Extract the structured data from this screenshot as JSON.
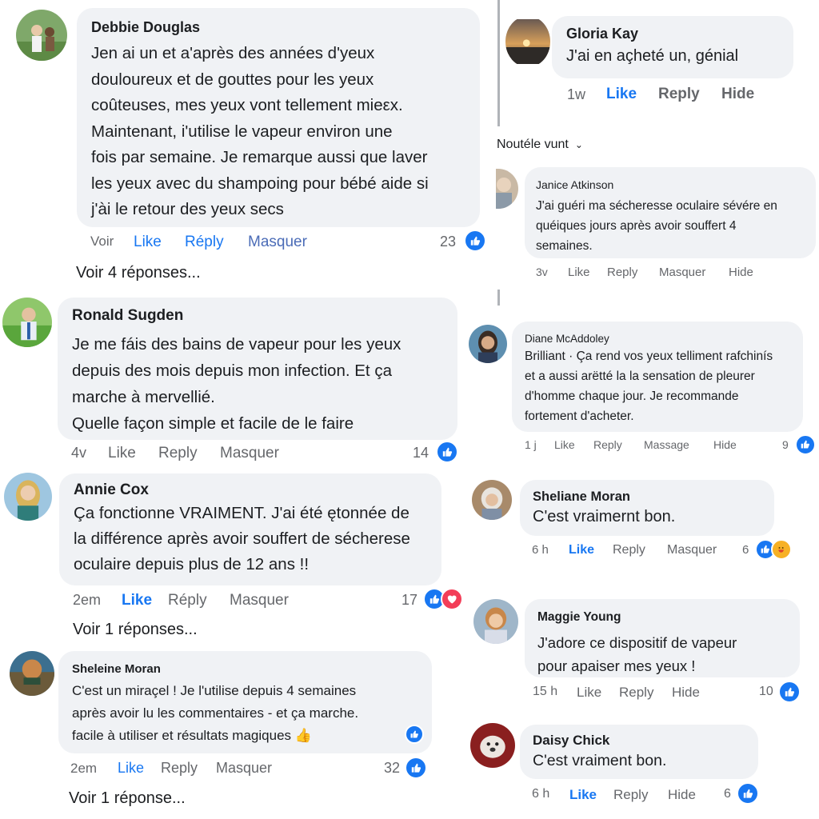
{
  "left": [
    {
      "name": "Debbie Douglas",
      "text": "Jen ai un et a'après des années d'yeux\ndouloureux et de gouttes pour les yeux\ncoûteuses, mes yeux vont tellement mieεx.\nMaintenant, i'utilise le vapeur environ une\nfois par semaine. Je remarque aussi que laver\nles yeux avec du shampoing pour bébé aide si\nj'ài le retour des yeux secs",
      "time": "Voir",
      "like": "Like",
      "reply": "Réply",
      "hide": "Masquer",
      "count": "23",
      "more": "Voir 4 réponses..."
    },
    {
      "name": "Ronald Sugden",
      "text": "Je me fáis des bains de vapeur pour les yeux\ndepuis des mois depuis mon infection. Et ça\nmarche à mervellié.\nQuelle façon simple et facile de le faire",
      "time": "4v",
      "like": "Like",
      "reply": "Reply",
      "hide": "Masquer",
      "count": "14"
    },
    {
      "name": "Annie Cox",
      "text": "Ça fonctionne VRAIMENT. J'ai été ętonnée de\nla différence après avoir souffert de sécherese\noculaire depuis plus de 12 ans !!",
      "time": "2em",
      "like": "Like",
      "reply": "Réply",
      "hide": "Masquer",
      "count": "17",
      "more": "Voir 1 réponses..."
    },
    {
      "name": "Sheleine Moran",
      "text": "C'est un miraçel ! Je l'utilise depuis 4 semaines\naprès avoir lu les commentaires - et ça marche.\nfacile à utiliser et résultats magiques 👍",
      "time": "2em",
      "like": "Like",
      "reply": "Reply",
      "hide": "Masquer",
      "count": "32",
      "more": "Voir 1 réponse..."
    }
  ],
  "right": [
    {
      "name": "Gloria Kay",
      "text": "J'ai en açheté un, génial",
      "time": "1w",
      "like": "Like",
      "reply": "Reply",
      "hide": "Hide"
    },
    {
      "name": "Janice Atkinson",
      "text": "J'ai guéri ma sécheresse oculaire sévére en\nquéiques jours après avoir souffert 4\nsemaines.",
      "time": "3v",
      "like": "Like",
      "reply": "Reply",
      "hide": "Masquer",
      "hide2": "Hide"
    },
    {
      "name": "Diane McAddoley",
      "text": "Brilliant · Ça rend vos yeux telliment rafchinís\net a aussi arëtté la la sensation de pleurer\nd'homme chaque jour. Je recommande\nfortement d'acheter.",
      "time": "1 j",
      "like": "Like",
      "reply": "Reply",
      "hide": "Massage",
      "hide2": "Hide",
      "count": "9"
    },
    {
      "name": "Sheliane Moran",
      "text": "C'est vraimernt bon.",
      "time": "6 h",
      "like": "Like",
      "reply": "Reply",
      "hide": "Masquer",
      "count": "6"
    },
    {
      "name": "Maggie Young",
      "text": "J'adore ce dispositif de vapeur\npour apaiser mes yeux !",
      "time": "15 h",
      "like": "Like",
      "reply": "Reply",
      "hide": "Hide",
      "count": "10"
    },
    {
      "name": "Daisy Chick",
      "text": "C'est vraiment bon.",
      "time": "6 h",
      "like": "Like",
      "reply": "Reply",
      "hide": "Hide",
      "count": "6"
    }
  ],
  "sort_label": "Noutéle vunt",
  "colors": {
    "accent": "#1877f2",
    "bubble": "#f0f2f5",
    "muted": "#65676b"
  }
}
